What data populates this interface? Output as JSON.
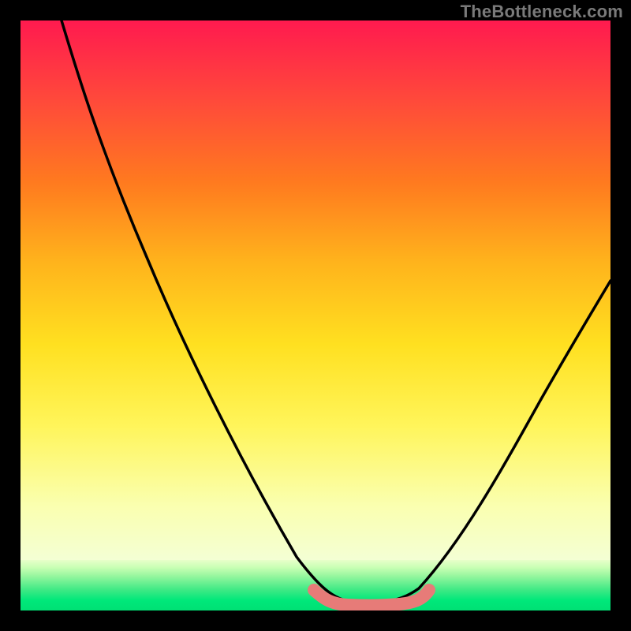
{
  "attribution": "TheBottleneck.com",
  "colors": {
    "frame": "#000000",
    "gradient_top": "#ff1a4f",
    "gradient_mid_upper": "#ff7a1f",
    "gradient_mid": "#ffe020",
    "gradient_lower": "#faffb0",
    "gradient_base": "#00e87a",
    "curve": "#000000",
    "highlight": "#e77b78"
  },
  "chart_data": {
    "type": "line",
    "title": "",
    "xlabel": "",
    "ylabel": "",
    "xlim": [
      0,
      100
    ],
    "ylim": [
      0,
      100
    ],
    "series": [
      {
        "name": "bottleneck-curve",
        "x": [
          7,
          15,
          25,
          35,
          45,
          50,
          55,
          58,
          60,
          65,
          70,
          75,
          85,
          100
        ],
        "values": [
          100,
          85,
          65,
          45,
          25,
          15,
          5,
          1,
          0,
          1,
          12,
          25,
          45,
          65
        ]
      },
      {
        "name": "optimal-zone-highlight",
        "x": [
          52,
          55,
          58,
          60,
          62,
          65,
          68
        ],
        "values": [
          3,
          1,
          0,
          0,
          0,
          1,
          3
        ]
      }
    ],
    "annotations": []
  }
}
